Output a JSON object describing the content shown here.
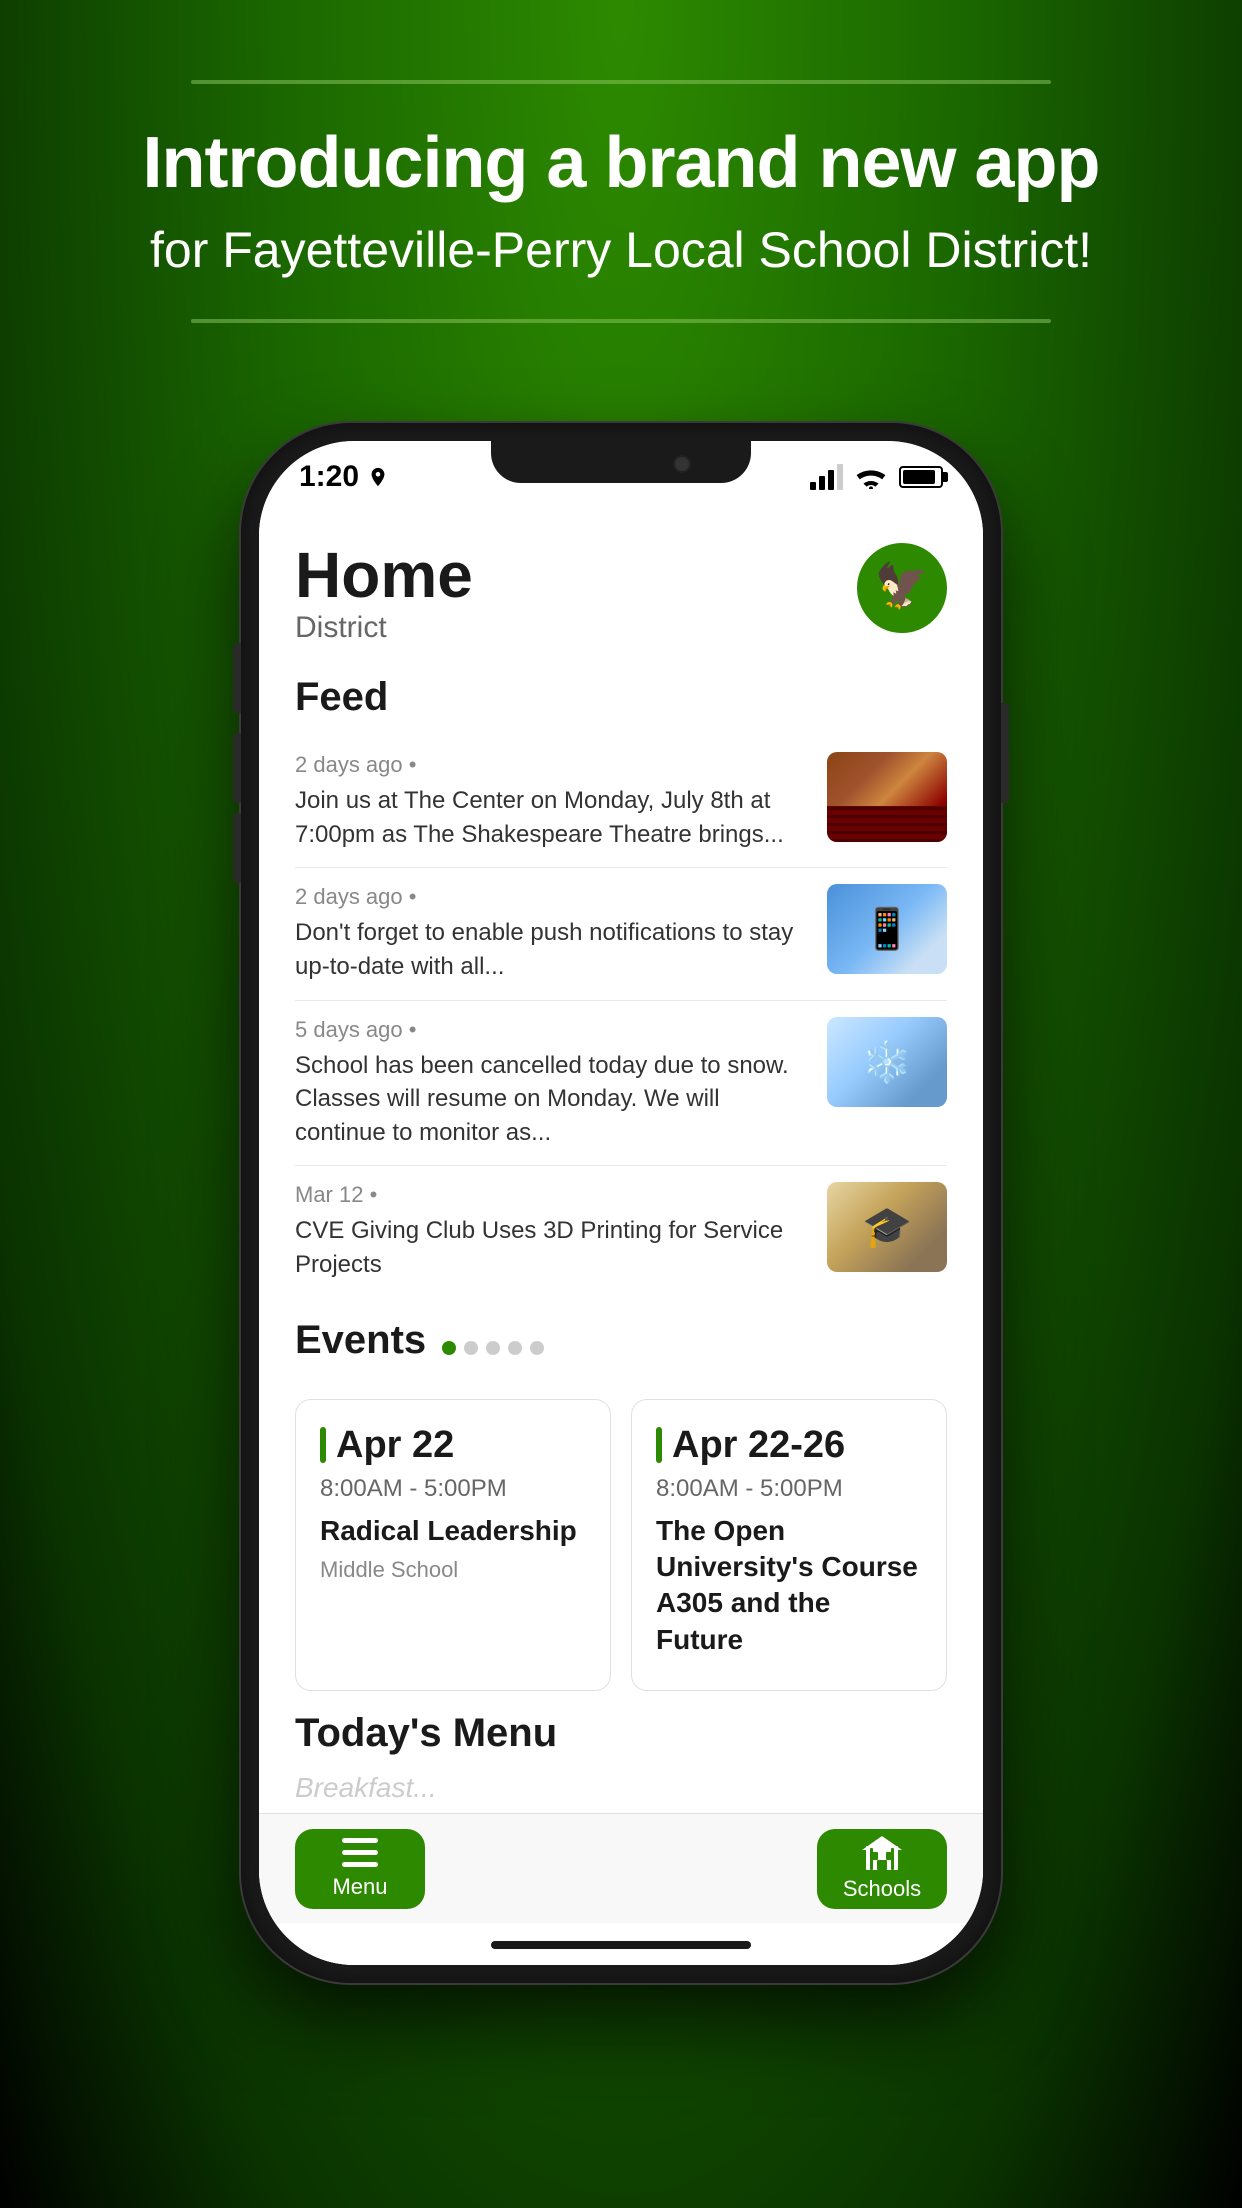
{
  "background": {
    "gradient_start": "#2d8a00",
    "gradient_end": "#000000"
  },
  "header": {
    "headline": "Introducing a brand new app",
    "subheadline": "for Fayetteville-Perry Local School District!"
  },
  "phone": {
    "status_bar": {
      "time": "1:20",
      "signal_label": "signal",
      "wifi_label": "wifi",
      "battery_label": "battery"
    },
    "app": {
      "title": "Home",
      "subtitle": "District",
      "feed_title": "Feed",
      "feed_items": [
        {
          "meta": "2 days ago",
          "description": "Join us at The Center on Monday, July 8th at 7:00pm as The Shakespeare Theatre brings...",
          "thumb_type": "theater"
        },
        {
          "meta": "2 days ago",
          "description": "Don't forget to enable push notifications to stay up-to-date with all...",
          "thumb_type": "phone"
        },
        {
          "meta": "5 days ago",
          "description": "School has been cancelled today due to snow. Classes will resume on Monday. We will continue to monitor as...",
          "thumb_type": "snow"
        },
        {
          "meta": "Mar 12",
          "description": "CVE Giving Club Uses 3D Printing for Service Projects",
          "thumb_type": "students"
        }
      ],
      "events_title": "Events",
      "events": [
        {
          "date": "Apr 22",
          "time": "8:00AM - 5:00PM",
          "name": "Radical Leadership",
          "location": "Middle School"
        },
        {
          "date": "Apr 22-26",
          "time": "8:00AM - 5:00PM",
          "name": "The Open University's Course A305 and the Future",
          "location": ""
        }
      ],
      "menu_title": "Today's Menu",
      "menu_placeholder": "Breakfast...",
      "nav": {
        "menu_label": "Menu",
        "schools_label": "Schools"
      }
    }
  }
}
